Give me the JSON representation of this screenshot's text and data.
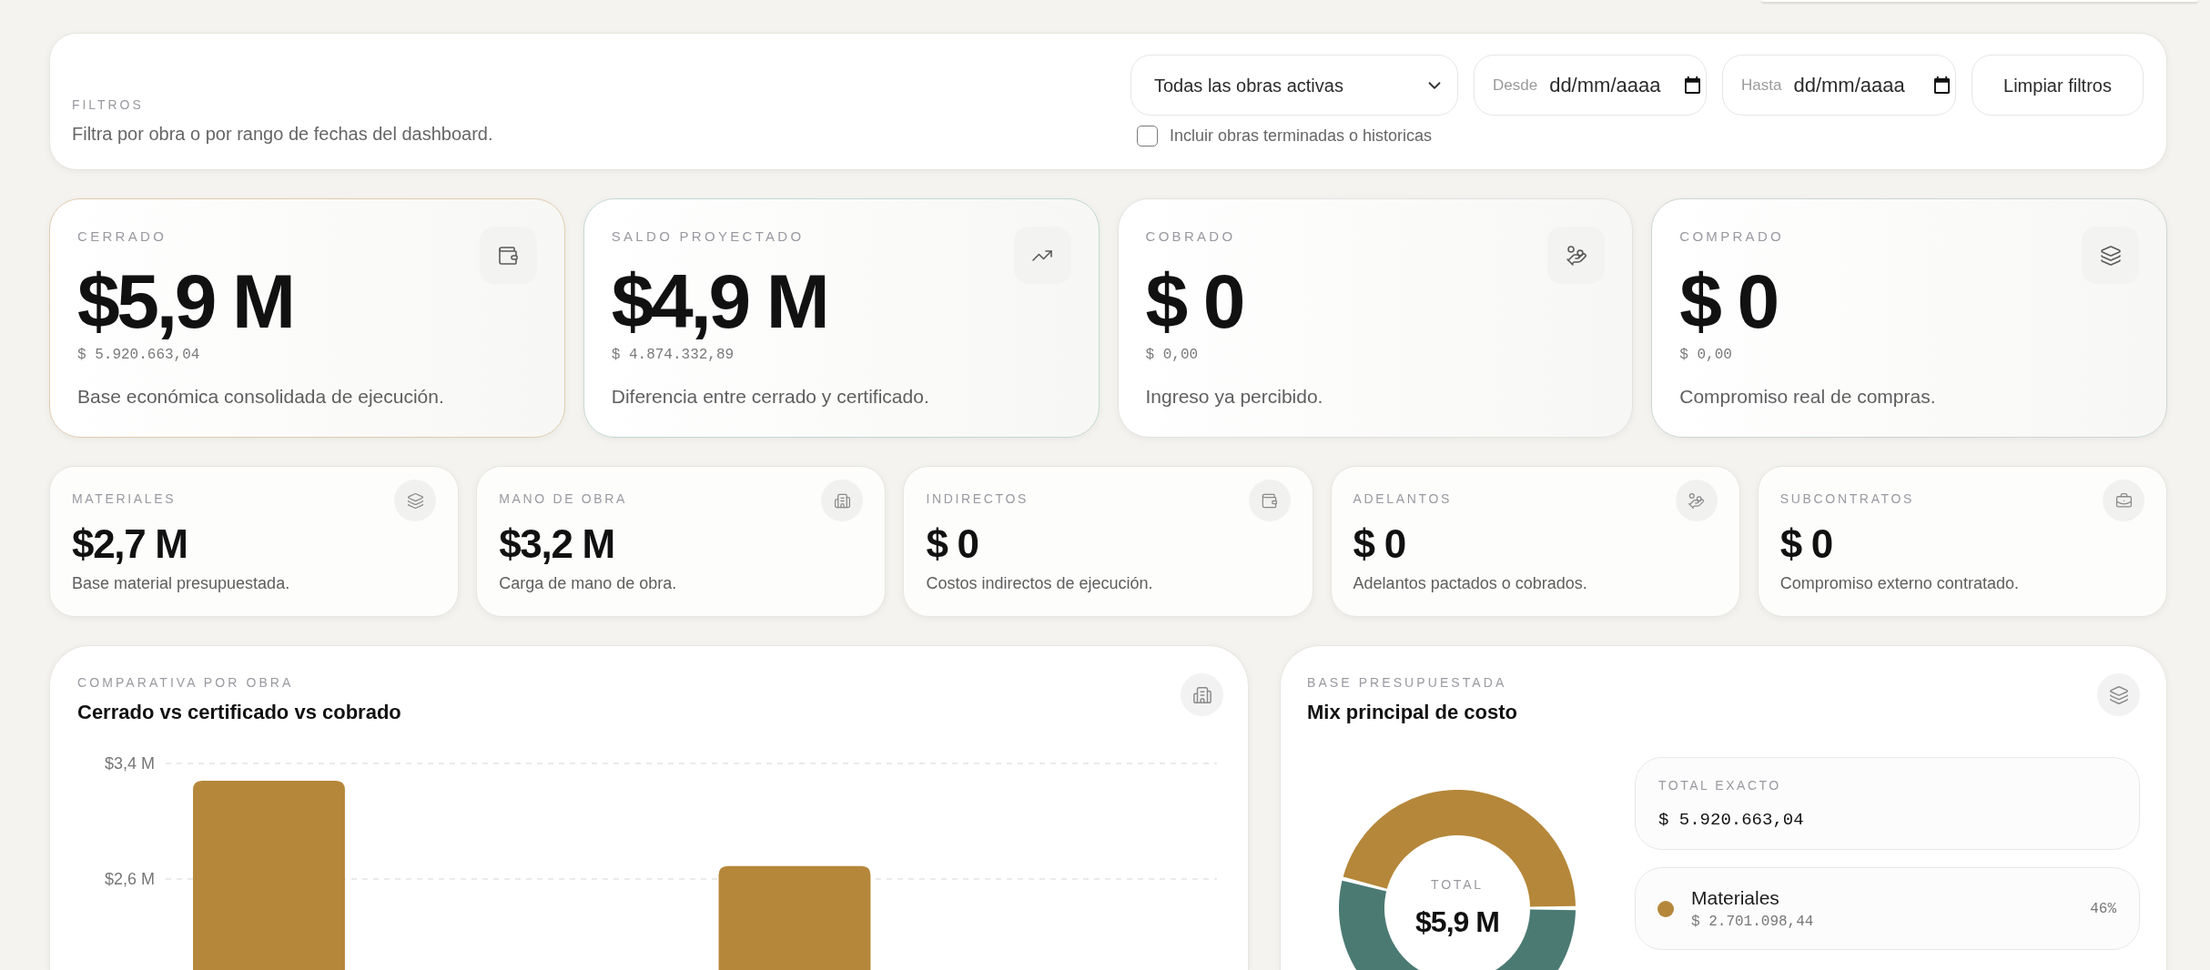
{
  "filters": {
    "title": "FILTROS",
    "description": "Filtra por obra o por rango de fechas del dashboard.",
    "obra_select": {
      "value": "Todas las obras activas"
    },
    "date_from": {
      "label": "Desde",
      "placeholder": "dd/mm/aaaa"
    },
    "date_to": {
      "label": "Hasta",
      "placeholder": "dd/mm/aaaa"
    },
    "clear_button": "Limpiar filtros",
    "include_finished": {
      "label": "Incluir obras terminadas o historicas",
      "checked": false
    }
  },
  "kpis": [
    {
      "label": "CERRADO",
      "value": "$5,9 M",
      "exact": "$ 5.920.663,04",
      "description": "Base económica consolidada de ejecución.",
      "color": "#e2cbb0"
    },
    {
      "label": "SALDO PROYECTADO",
      "value": "$4,9 M",
      "exact": "$ 4.874.332,89",
      "description": "Diferencia entre cerrado y certificado.",
      "color": "#c4d8d4"
    },
    {
      "label": "COBRADO",
      "value": "$ 0",
      "exact": "$ 0,00",
      "description": "Ingreso ya percibido.",
      "color": "#e2e2e2"
    },
    {
      "label": "COMPRADO",
      "value": "$ 0",
      "exact": "$ 0,00",
      "description": "Compromiso real de compras.",
      "color": "#cdd6d3"
    }
  ],
  "cost_cards": [
    {
      "label": "MATERIALES",
      "value": "$2,7 M",
      "description": "Base material presupuestada."
    },
    {
      "label": "MANO DE OBRA",
      "value": "$3,2 M",
      "description": "Carga de mano de obra."
    },
    {
      "label": "INDIRECTOS",
      "value": "$ 0",
      "description": "Costos indirectos de ejecución."
    },
    {
      "label": "ADELANTOS",
      "value": "$ 0",
      "description": "Adelantos pactados o cobrados."
    },
    {
      "label": "SUBCONTRATOS",
      "value": "$ 0",
      "description": "Compromiso externo contratado."
    }
  ],
  "comparison": {
    "eyebrow": "COMPARATIVA POR OBRA",
    "title": "Cerrado vs certificado vs cobrado",
    "chart_data": {
      "type": "bar",
      "ylim": [
        1.97,
        3.4
      ],
      "yticks": [
        {
          "value": 2.6,
          "label": "$2,6 M"
        },
        {
          "value": 3.4,
          "label": "$3,4 M"
        }
      ],
      "series": [
        {
          "color": "#b5873a",
          "values": [
            3.28,
            2.69
          ]
        }
      ]
    }
  },
  "cost_mix": {
    "eyebrow": "BASE PRESUPUESTADA",
    "title": "Mix principal de costo",
    "chart_data": {
      "type": "donut",
      "values": [
        46,
        54
      ],
      "colors": [
        "#b5873a",
        "#4b7a73"
      ]
    },
    "center_label": "TOTAL",
    "center_value": "$5,9 M",
    "total": {
      "label": "TOTAL EXACTO",
      "value": "$ 5.920.663,04"
    },
    "legend": [
      {
        "name": "Materiales",
        "amount": "$ 2.701.098,44",
        "share": "46%",
        "color": "#b5873a"
      }
    ]
  }
}
